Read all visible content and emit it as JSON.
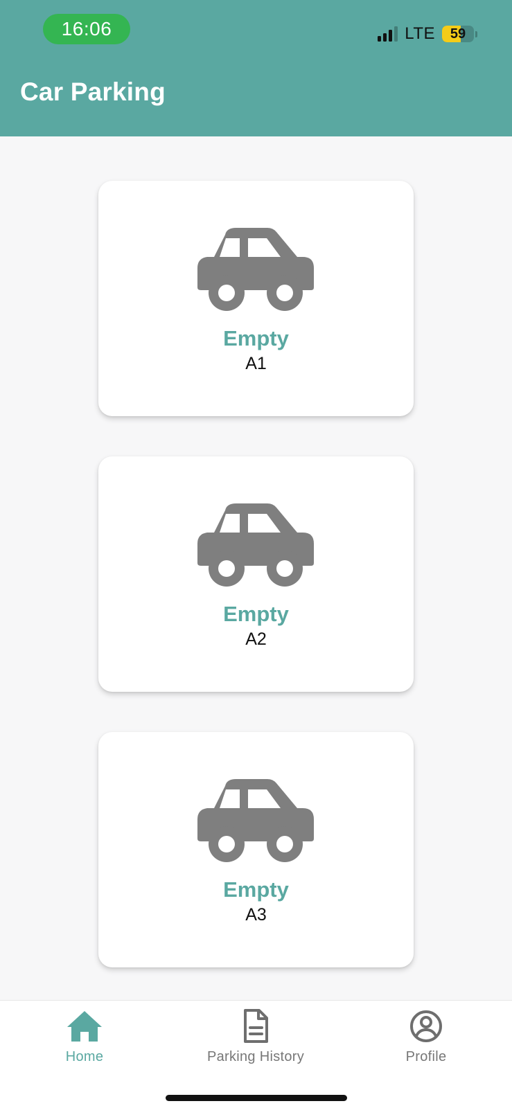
{
  "status_bar": {
    "time": "16:06",
    "network": "LTE",
    "battery": "59",
    "battery_level": 0.59,
    "signal_bars_active": 3,
    "signal_bars_total": 4
  },
  "header": {
    "title": "Car Parking"
  },
  "slots": [
    {
      "status": "Empty",
      "name": "A1"
    },
    {
      "status": "Empty",
      "name": "A2"
    },
    {
      "status": "Empty",
      "name": "A3"
    }
  ],
  "bottom_nav": {
    "items": [
      {
        "label": "Home",
        "icon": "home-icon",
        "active": true
      },
      {
        "label": "Parking History",
        "icon": "document-icon",
        "active": false
      },
      {
        "label": "Profile",
        "icon": "profile-icon",
        "active": false
      }
    ]
  },
  "colors": {
    "primary": "#5aa8a1",
    "status_pill": "#34b552",
    "icon_gray": "#7f7f7f",
    "battery": "#f5cc18"
  }
}
